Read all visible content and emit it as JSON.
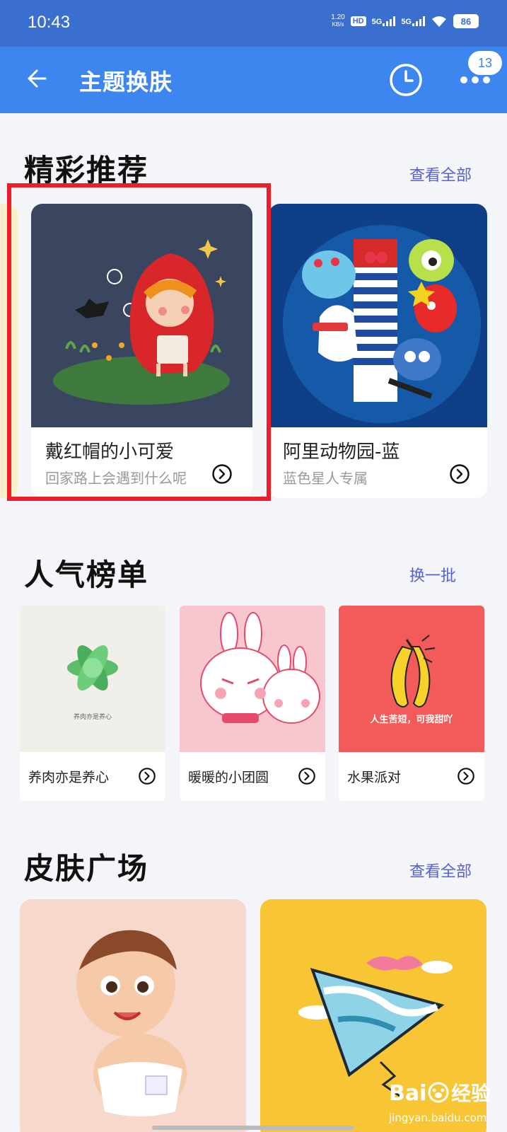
{
  "status_bar": {
    "time": "10:43",
    "speed_value": "1.20",
    "speed_unit": "KB/s",
    "hd_label": "HD",
    "sim1_label": "5G",
    "sim2_label": "5G",
    "battery": "86"
  },
  "appbar": {
    "title": "主题换肤",
    "notification_count": "13"
  },
  "recommend": {
    "title": "精彩推荐",
    "link": "查看全部",
    "cards": [
      {
        "name": "戴红帽的小可爱",
        "desc": "回家路上会遇到什么呢"
      },
      {
        "name": "阿里动物园-蓝",
        "desc": "蓝色星人专属"
      }
    ]
  },
  "popular": {
    "title": "人气榜单",
    "link": "换一批",
    "cards": [
      {
        "name": "养肉亦是养心",
        "image_text": "养肉亦是养心"
      },
      {
        "name": "暖暖的小团圆"
      },
      {
        "name": "水果派对",
        "image_text": "人生苦短，可我甜吖"
      }
    ]
  },
  "plaza": {
    "title": "皮肤广场",
    "link": "查看全部"
  },
  "watermark": {
    "brand": "Bai",
    "brand_suffix": "经验",
    "url": "jingyan.baidu.com"
  },
  "colors": {
    "status_bar": "#3a6fd0",
    "appbar": "#3d86f0",
    "section_link": "#5660d8",
    "highlight": "#ef1c2a"
  }
}
